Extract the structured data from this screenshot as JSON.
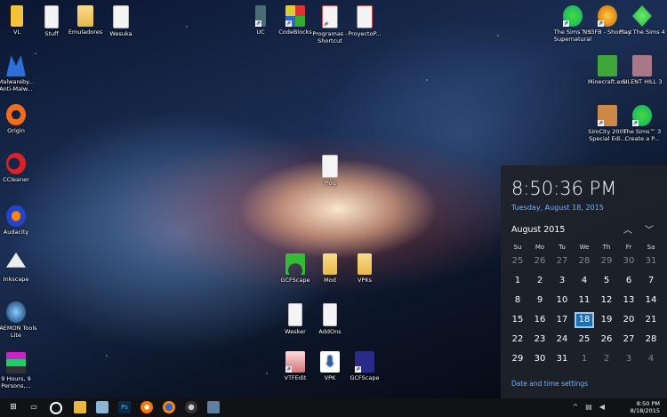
{
  "desktop": {
    "icons": [
      {
        "name": "vl",
        "label": "VL"
      },
      {
        "name": "stuff",
        "label": "Stuff"
      },
      {
        "name": "emuladores",
        "label": "Emuladores"
      },
      {
        "name": "wesuka",
        "label": "Wesuka"
      },
      {
        "name": "uc",
        "label": "UC"
      },
      {
        "name": "codeblocks",
        "label": "CodeBlocks"
      },
      {
        "name": "programas",
        "label": "Programas - Shortcut"
      },
      {
        "name": "proyecto",
        "label": "ProyectoP..."
      },
      {
        "name": "sims3-supernatural",
        "label": "The Sims™ 3 Supernatural"
      },
      {
        "name": "ns3fb",
        "label": "NS3FB - Shortcut"
      },
      {
        "name": "sims4",
        "label": "Play The Sims 4"
      },
      {
        "name": "malwarebytes",
        "label": "Malwareby... Anti-Malw..."
      },
      {
        "name": "minecraft",
        "label": "Minecraft.exe"
      },
      {
        "name": "silenthill",
        "label": "SILENT HILL 3"
      },
      {
        "name": "origin",
        "label": "Origin"
      },
      {
        "name": "simcity",
        "label": "SimCity 2000 Special Edi..."
      },
      {
        "name": "sims3-create",
        "label": "The Sims™ 3 Create a P..."
      },
      {
        "name": "ccleaner",
        "label": "CCleaner"
      },
      {
        "name": "audacity",
        "label": "Audacity"
      },
      {
        "name": "inkscape",
        "label": "Inkscape"
      },
      {
        "name": "daemon",
        "label": "DAEMON Tools Lite"
      },
      {
        "name": "9hours",
        "label": "9 Hours, 9 Persons,..."
      },
      {
        "name": "plog",
        "label": "Plog"
      },
      {
        "name": "gcfscape-green",
        "label": "GCFScape"
      },
      {
        "name": "mod",
        "label": "Mod"
      },
      {
        "name": "vpks",
        "label": "VPKs"
      },
      {
        "name": "wesker",
        "label": "Wesker"
      },
      {
        "name": "addons",
        "label": "AddOns"
      },
      {
        "name": "vtfedit",
        "label": "VTFEdit"
      },
      {
        "name": "vpk",
        "label": "VPK"
      },
      {
        "name": "gcfscape",
        "label": "GCFScape"
      }
    ]
  },
  "clock": {
    "time": "8:50:36 PM",
    "date": "Tuesday, August 18, 2015",
    "month": "August 2015",
    "weekdays": [
      "Su",
      "Mo",
      "Tu",
      "We",
      "Th",
      "Fr",
      "Sa"
    ],
    "rows": [
      [
        "25",
        "26",
        "27",
        "28",
        "29",
        "30",
        "31"
      ],
      [
        "1",
        "2",
        "3",
        "4",
        "5",
        "6",
        "7"
      ],
      [
        "8",
        "9",
        "10",
        "11",
        "12",
        "13",
        "14"
      ],
      [
        "15",
        "16",
        "17",
        "18",
        "19",
        "20",
        "21"
      ],
      [
        "22",
        "23",
        "24",
        "25",
        "26",
        "27",
        "28"
      ],
      [
        "29",
        "30",
        "31",
        "1",
        "2",
        "3",
        "4"
      ]
    ],
    "today": "18",
    "settings_link": "Date and time settings",
    "accent": "#1f6fb0"
  },
  "taskbar": {
    "time": "8:50 PM",
    "date": "8/18/2015",
    "apps": [
      "start-icon",
      "task-view-icon",
      "cortana-icon",
      "file-explorer-icon",
      "notepad-icon",
      "photoshop-icon",
      "blender-icon",
      "firefox-icon",
      "steam-icon",
      "steam-alt-icon"
    ],
    "ps_label": "Ps"
  }
}
